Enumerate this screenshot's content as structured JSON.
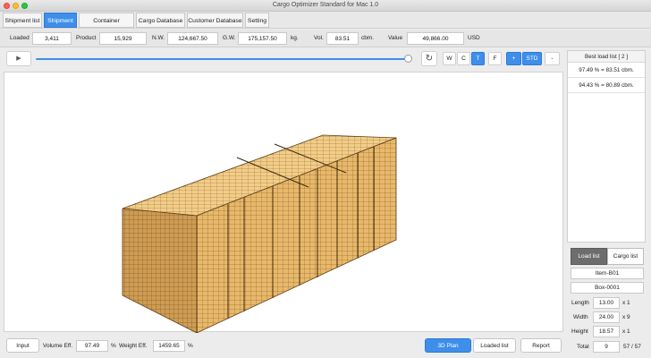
{
  "window": {
    "title": "Cargo Optimizer Standard for Mac 1.0"
  },
  "tabs": [
    "Shipment list",
    "Shipment",
    "Container Database",
    "Cargo Database",
    "Customer Database",
    "Setting"
  ],
  "summary": {
    "loaded_label": "Loaded",
    "loaded": "3,411",
    "product_label": "Product",
    "product": "15,929",
    "nw_label": "N.W.",
    "nw": "124,667.50",
    "gw_label": "G.W.",
    "gw": "175,157.50",
    "kg": "kg.",
    "vol_label": "Vol.",
    "vol": "83.51",
    "cbm": "cbm.",
    "value_label": "Value",
    "value": "49,866.00",
    "currency": "USD"
  },
  "toolbar": {
    "play": "▶",
    "refresh": "↻",
    "slider_progress": 1.0,
    "view_w": "W",
    "view_c": "C",
    "view_t": "T",
    "view_f": "F",
    "zoom_in": "+",
    "std": "STD",
    "zoom_out": "-"
  },
  "best_load": {
    "header": "Best load list [ 2 ]",
    "items": [
      "97.49 % = 83.51 cbm.",
      "94.43 % = 80.89 cbm."
    ]
  },
  "lists": {
    "load_list": "Load list",
    "cargo_list": "Cargo list"
  },
  "detail": {
    "item": "Item-B01",
    "box": "Box-0001",
    "length_label": "Length",
    "length": "13.00",
    "length_mult": "x 1",
    "width_label": "Width",
    "width": "24.00",
    "width_mult": "x 9",
    "height_label": "Height",
    "height": "18.57",
    "height_mult": "x 1",
    "total_label": "Total",
    "total": "9",
    "total_count": "57 / 57"
  },
  "bottom": {
    "input": "Input",
    "vol_eff_label": "Volume Eff.",
    "vol_eff": "97.49",
    "pct1": "%",
    "wt_eff_label": "Weight Eff.",
    "wt_eff": "1459.65",
    "pct2": "%",
    "plan_3d": "3D Plan",
    "loaded_list": "Loaded list",
    "report": "Report"
  },
  "colors": {
    "accent": "#3d8fea",
    "cargo_light": "#f0c47c",
    "cargo_mid": "#dca75e",
    "cargo_dark": "#b8843f",
    "cargo_line": "#5b3e14"
  }
}
